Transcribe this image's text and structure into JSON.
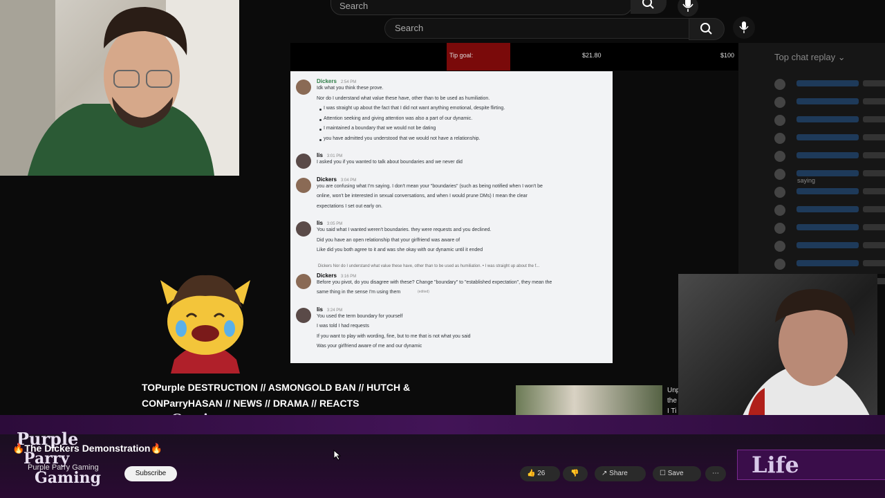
{
  "search": {
    "placeholder_top": "Search",
    "placeholder": "Search"
  },
  "tip_goal": {
    "label": "Tip goal:",
    "current": "$21.80",
    "target": "$100"
  },
  "chat": {
    "title": "Top chat replay",
    "snippet": "saying"
  },
  "discord": {
    "messages": [
      {
        "author": "Dickers",
        "time": "2:54 PM",
        "lines": [
          "Idk what you think these prove.",
          "Nor do I understand what value these have, other than to be used as humiliation."
        ],
        "bullets": [
          "I was straight up about the fact that I did not want anything emotional, despite flirting.",
          "Attention seeking and giving attention was also a part of our dynamic.",
          "I maintained a boundary that we would not be dating",
          "you have admitted you understood that we would not have a relationship."
        ]
      },
      {
        "author": "lis",
        "time": "3:01 PM",
        "lines": [
          "I asked you if you wanted to talk about boundaries and we never did"
        ]
      },
      {
        "author": "Dickers",
        "time": "3:04 PM",
        "lines": [
          "you are confusing what I'm saying. I don't mean your \"boundaries\" (such as being notified when I won't be",
          "online, won't be interested in sexual conversations, and when I would prune DMs) I mean the clear",
          "expectations I set out early on."
        ]
      },
      {
        "author": "lis",
        "time": "3:05 PM",
        "lines": [
          "You said what I wanted weren't boundaries. they were requests and you declined.",
          "Did you have an open relationship that your girlfriend was aware of",
          "Like did you both agree to it and was she okay with our dynamic until it ended"
        ]
      },
      {
        "author": "Dickers",
        "time": "3:16 PM",
        "reply": "Dickers  Nor do I understand what value these have, other than to be used as humiliation. • I was straight up about the f...",
        "lines": [
          "Before you pivot, do you disagree with these? Change \"boundary\" to \"established expectation\", they mean the",
          "same thing in the sense I'm using them"
        ],
        "edited": "(edited)"
      },
      {
        "author": "lis",
        "time": "3:24 PM",
        "lines": [
          "You used the term boundary for yourself",
          "I was told I had requests",
          "If you want to play with wording, fine, but to me that is not what you said",
          "Was your girlfriend aware of me and our dynamic"
        ]
      }
    ]
  },
  "video": {
    "title_line1": "TOPurple DESTRUCTION // ASMONGOLD BAN // HUTCH &",
    "title_line2": "CONParryHASAN // NEWS // DRAMA // REACTS",
    "side_text": [
      "Unp",
      "the",
      "I Ti"
    ]
  },
  "overlay_logo": {
    "line1": "Purple",
    "line2": "Parry",
    "line3": "Gaming"
  },
  "bottom": {
    "stream_title": "🔥The Dickers Demonstration🔥",
    "channel": "Purple Parry Gaming",
    "subscribe": "Subscribe",
    "likes": "26",
    "share": "Share",
    "save": "Save",
    "life_banner": "Life"
  },
  "colors": {
    "tip_fill": "#7a0a0a",
    "purple": "#421457",
    "discord_bg": "#f2f3f5"
  }
}
